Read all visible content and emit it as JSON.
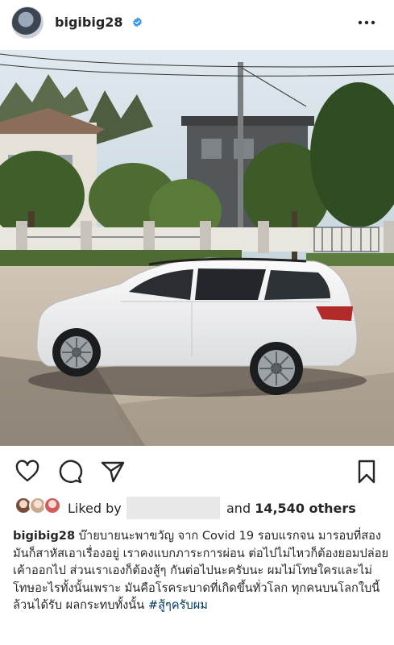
{
  "post": {
    "username": "bigibig28",
    "verified": true
  },
  "header": {
    "more_icon": "more-horizontal-icon"
  },
  "photo": {
    "subject": "white-suv-photo"
  },
  "actions": {
    "icons": [
      "heart-icon",
      "comment-icon",
      "share-icon",
      "bookmark-icon"
    ]
  },
  "likes": {
    "liked_by_label": "Liked by",
    "and_label": "and",
    "count": "14,540 others"
  },
  "caption": {
    "username": "bigibig28",
    "text": "บ๊ายบายนะพาขวัญ จาก Covid 19 รอบแรกจน มารอบที่สอง มันก็สาหัสเอาเรื่องอยู่ เราคงแบกภาระการผ่อน ต่อไปไม่ไหวก็ต้องยอมปล่อยเค้าออกไป ส่วนเราเองก็ต้องสู้ๆ กันต่อไปนะครับนะ ผมไม่โทษใครและไม่โทษอะไรทั้งนั้นเพราะ มันคือโรคระบาดที่เกิดขึ้นทั่วโลก ทุกคนบนโลกใบนี้ล้วนได้รับ ผลกระทบทั้งนั้น",
    "hashtag": "#สู้ๆครับผม"
  },
  "colors": {
    "verified": "#3897f0",
    "hashtag": "#00376b",
    "text": "#262626"
  }
}
